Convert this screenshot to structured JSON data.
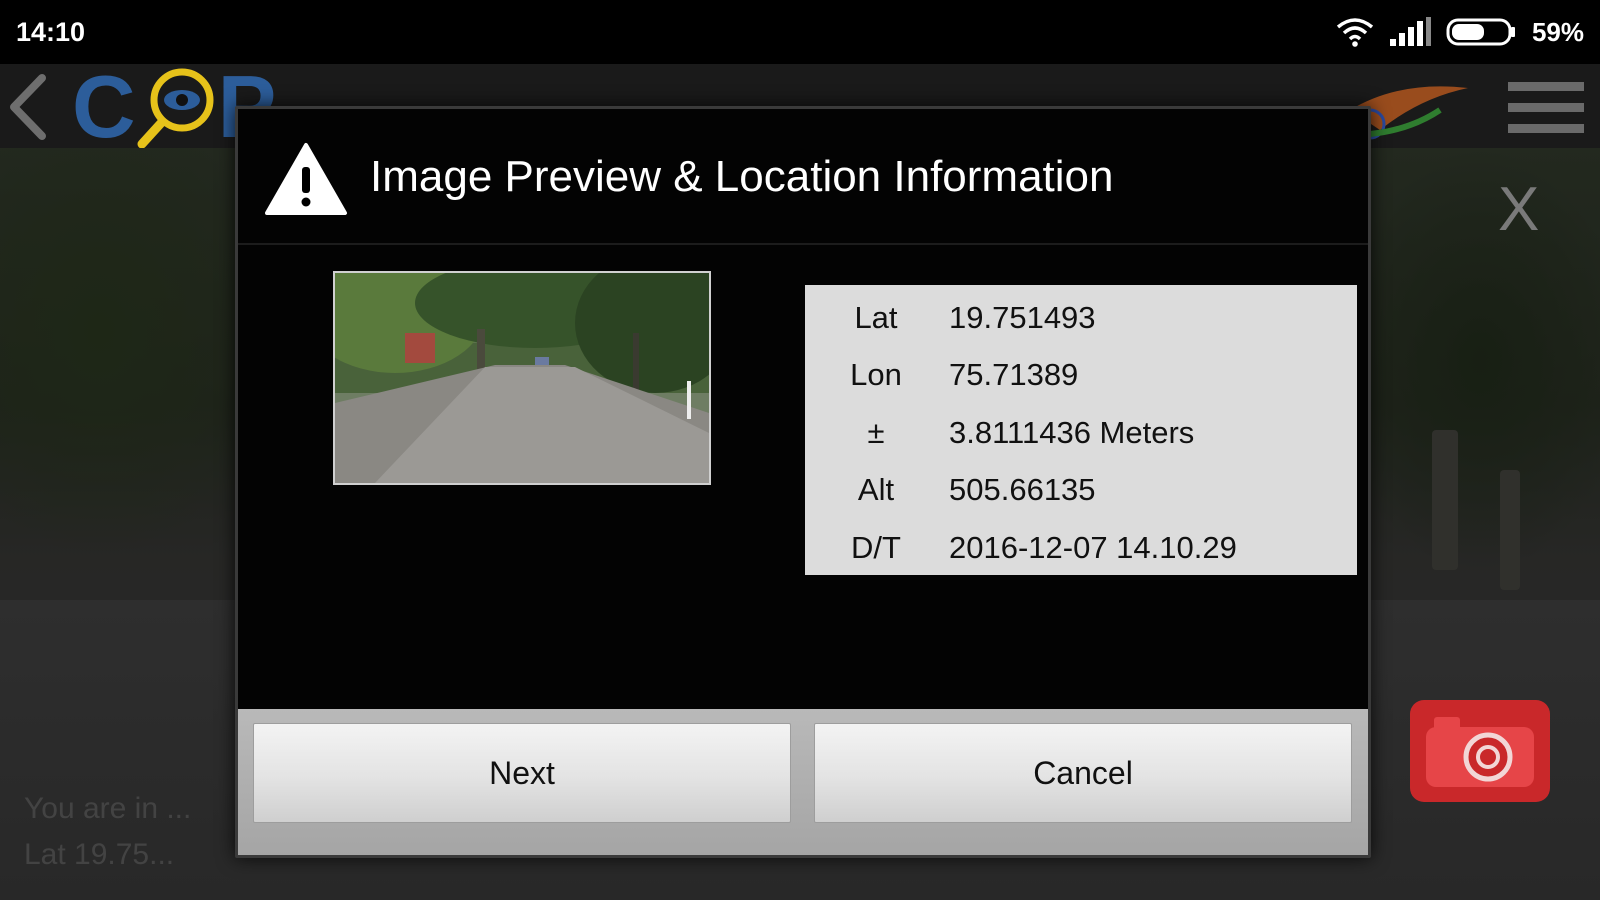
{
  "status_bar": {
    "time": "14:10",
    "battery_percent_text": "59%",
    "battery_level": 0.59,
    "icons": [
      "wifi-icon",
      "signal-icon",
      "battery-icon"
    ]
  },
  "app_bar": {
    "logo_letters": [
      "C",
      "P"
    ],
    "icons": [
      "back-icon",
      "magnifier-eye-icon",
      "flag-emblem-icon",
      "menu-icon"
    ]
  },
  "overlay": {
    "close_label": "X"
  },
  "dialog": {
    "title": "Image Preview & Location Information",
    "icon": "warning-icon",
    "location": [
      {
        "label": "Lat",
        "value": "19.751493"
      },
      {
        "label": "Lon",
        "value": "75.71389"
      },
      {
        "label": "±",
        "value": "3.8111436 Meters"
      },
      {
        "label": "Alt",
        "value": "505.66135"
      },
      {
        "label": "D/T",
        "value": "2016-12-07 14.10.29"
      }
    ],
    "buttons": {
      "next_label": "Next",
      "cancel_label": "Cancel"
    }
  },
  "colors": {
    "logo_blue": "#2c5d9a",
    "logo_yellow": "#e6c21a",
    "camera_red": "#c9282a",
    "info_panel_bg": "#dcdcdc"
  }
}
